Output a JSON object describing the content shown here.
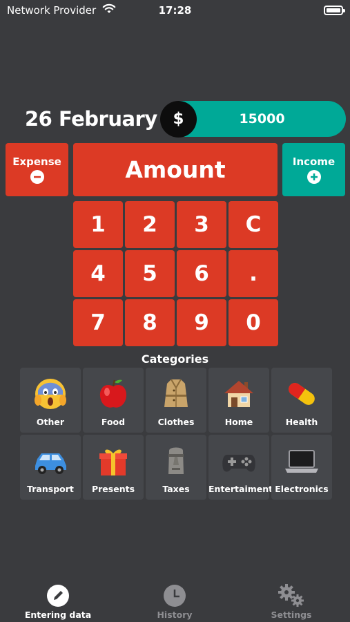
{
  "status_bar": {
    "provider": "Network Provider",
    "time": "17:28"
  },
  "header": {
    "date": "26 February",
    "currency_symbol": "$",
    "balance": "15000"
  },
  "entry": {
    "expense_label": "Expense",
    "income_label": "Income",
    "amount_placeholder": "Amount"
  },
  "keypad": {
    "keys": [
      "1",
      "2",
      "3",
      "C",
      "4",
      "5",
      "6",
      ".",
      "7",
      "8",
      "9",
      "0"
    ]
  },
  "categories": {
    "title": "Categories",
    "items": [
      {
        "label": "Other",
        "icon": "screaming-face-icon"
      },
      {
        "label": "Food",
        "icon": "red-apple-icon"
      },
      {
        "label": "Clothes",
        "icon": "coat-icon"
      },
      {
        "label": "Home",
        "icon": "house-icon"
      },
      {
        "label": "Health",
        "icon": "pill-icon"
      },
      {
        "label": "Transport",
        "icon": "car-icon"
      },
      {
        "label": "Presents",
        "icon": "gift-icon"
      },
      {
        "label": "Taxes",
        "icon": "moai-icon"
      },
      {
        "label": "Entertaiments",
        "icon": "gamepad-icon"
      },
      {
        "label": "Electronics",
        "icon": "laptop-icon"
      }
    ]
  },
  "tabbar": {
    "tabs": [
      {
        "label": "Entering data",
        "active": true
      },
      {
        "label": "History",
        "active": false
      },
      {
        "label": "Settings",
        "active": false
      }
    ]
  },
  "colors": {
    "background": "#3a3b3e",
    "expense": "#dc3a25",
    "income": "#00a997",
    "tile": "#45474b"
  }
}
